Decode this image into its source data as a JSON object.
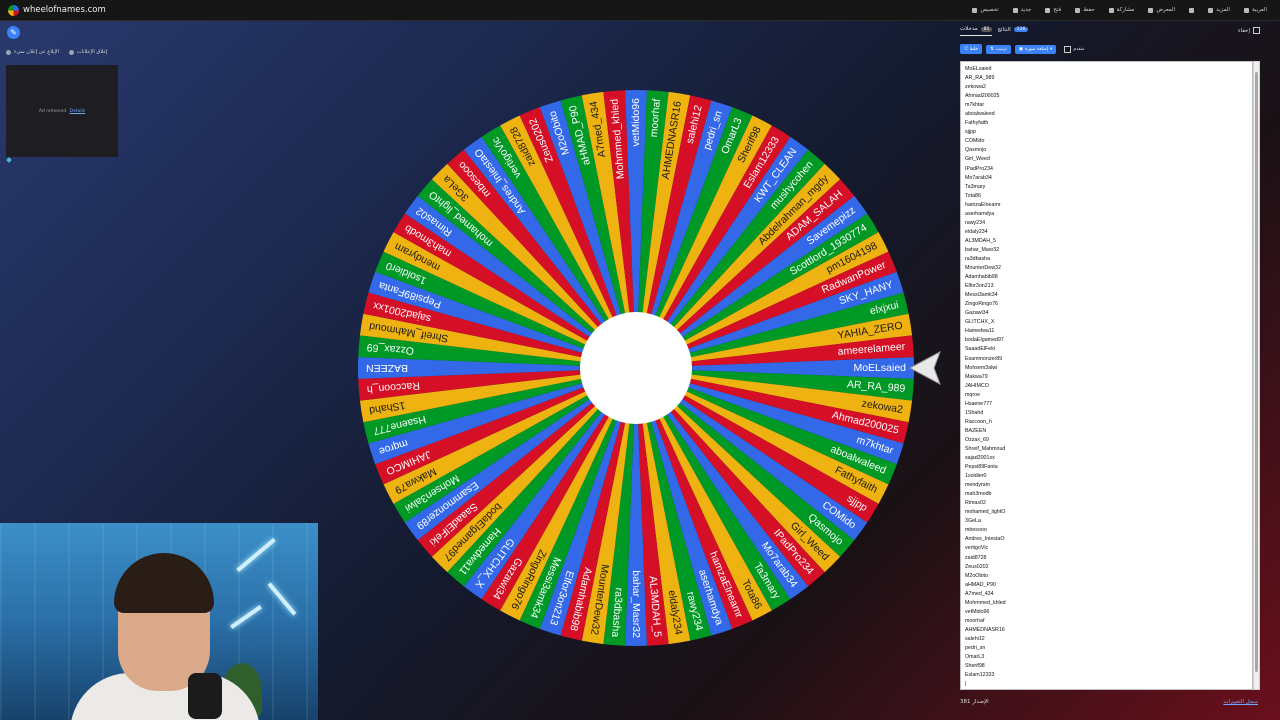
{
  "topbar": {
    "site": "wheelofnames.com",
    "menu": [
      "العربية",
      "المزيد",
      "المعرض",
      "مشاركة",
      "حفظ",
      "فتح",
      "جديد",
      "تخصيص"
    ]
  },
  "left_panel": {
    "report_link": "الإبلاغ عن إعلان سيء",
    "close_ads": "إغلاق الإعلانات",
    "ad_removed": "Ad removed.",
    "details": "Details"
  },
  "wheel": {
    "colors": [
      "#3369e8",
      "#009925",
      "#eeb211",
      "#d50f25"
    ],
    "labels": [
      "MoELsaied",
      "AR_RA_989",
      "zekowa2",
      "Ahmad200025",
      "m7khtar",
      "aboalwaleed",
      "Fathyfaith",
      "sjjpp",
      "COMido",
      "Qasmojo",
      "Girl_Weed",
      "IPadPro234",
      "Mo7arab34",
      "Ta3mary",
      "Tota86",
      "hamzaElneamr",
      "aserhamdya",
      "rawy234",
      "eldaly234",
      "AL3MDAH_5",
      "bahar_Masr32",
      "ra3dbasha",
      "MounterDew32",
      "Adamhabib98",
      "Elfor3on213",
      "Messi3amk34",
      "ZingoRingo76",
      "Gazawi34",
      "GLITCHX_X",
      "Hamedwa11",
      "bodaEIgamed97",
      "SaaadElFeki",
      "Esammonzer89",
      "Mohsen3alwi",
      "Makwa79",
      "JAHIMCO",
      "mqroe",
      "Hsaene777",
      "1Shahd",
      "Raccoon_h",
      "BAZEEN",
      "Ozzax_69",
      "Shreif_Mahmoud",
      "sajad2001xx",
      "Pepsi89Fanta",
      "1soldier0",
      "mendyram",
      "mah3modb",
      "Rimas02",
      "mohamed_lightO",
      "3GeLa",
      "mbesooo",
      "Andres_IniestaO",
      "vertigoVic",
      "zaid8728",
      "Zeus0202",
      "M2oObito",
      "aHMAD_P90",
      "A7med_434",
      "Mohmmed_khled",
      "vetMido96",
      "moorhaf",
      "AHMEDNASR16",
      "salehi12",
      "pedri_sn",
      "OmarL3",
      "Sherif98",
      "Eslam12333",
      "KWT_CLEAN",
      "mushycohen",
      "Abdelrahman_mgdy",
      "ADAM_SALAH",
      "Savemepizz",
      "Scottlord_1930774",
      "pm1604198",
      "RadwanPower",
      "SKY_HANY",
      "elxjxui",
      "YAHIA_ZERO",
      "ameerelameer"
    ]
  },
  "right_panel": {
    "tab_entries": "مدخلات",
    "tab_entries_count": "81",
    "tab_results": "النتائج",
    "tab_results_count": "116",
    "hide_label": "إخفاء",
    "toolbar": {
      "shuffle": "خلط",
      "sort": "ترتيب",
      "add_image": "إضافة صورة",
      "advanced": "متقدم"
    },
    "entries": [
      "MoELsaied",
      "AR_RA_989",
      "zekowa2",
      "Ahmad200025",
      "m7khtar",
      "aboalwaleed",
      "Fathyfaith",
      "sjjpp",
      "COMido",
      "Qasmojo",
      "Girl_Weed",
      "IPadPro234",
      "Mo7arab34",
      "Ta3mary",
      "Tota86",
      "hamzaElneamr",
      "aserhamdya",
      "rawy234",
      "eldaly234",
      "AL3MDAH_5",
      "bahar_Masr32",
      "ra3dbasha",
      "MounterDew32",
      "Adamhabib98",
      "Elfor3on213",
      "Messi3amk34",
      "ZingoRingo76",
      "Gazawi34",
      "GLITCHX_X",
      "Hamedwa11",
      "bodaEIgamed97",
      "SaaadElFeki",
      "Esammonzer89",
      "Mohsem3alwi",
      "Makwa79",
      "JAHIMCO",
      "mqroe",
      "Hsaene777",
      "1Shahd",
      "Raccoon_h",
      "BAZEEN",
      "Ozzax_69",
      "Shreif_Mahmoud",
      "sajad2001xx",
      "Pepsi89Fanta",
      "1soldier0",
      "mendyram",
      "mah3modb",
      "Rimas02",
      "mohamed_lightO",
      "3GeLa",
      "mbesooo",
      "Andres_IniestaO",
      "vertigoVic",
      "zaid8728",
      "Zeus0202",
      "M2oObito",
      "aHMAD_P90",
      "A7med_434",
      "Mohmmed_khled",
      "vetMido96",
      "moorhaf",
      "AHMEDNASR16",
      "salehi12",
      "pedri_sn",
      "OmarL3",
      "Sherif98",
      "Eslam12333",
      "|"
    ],
    "version": "381 الإصدار",
    "changelog": "سجل التغييرات"
  }
}
